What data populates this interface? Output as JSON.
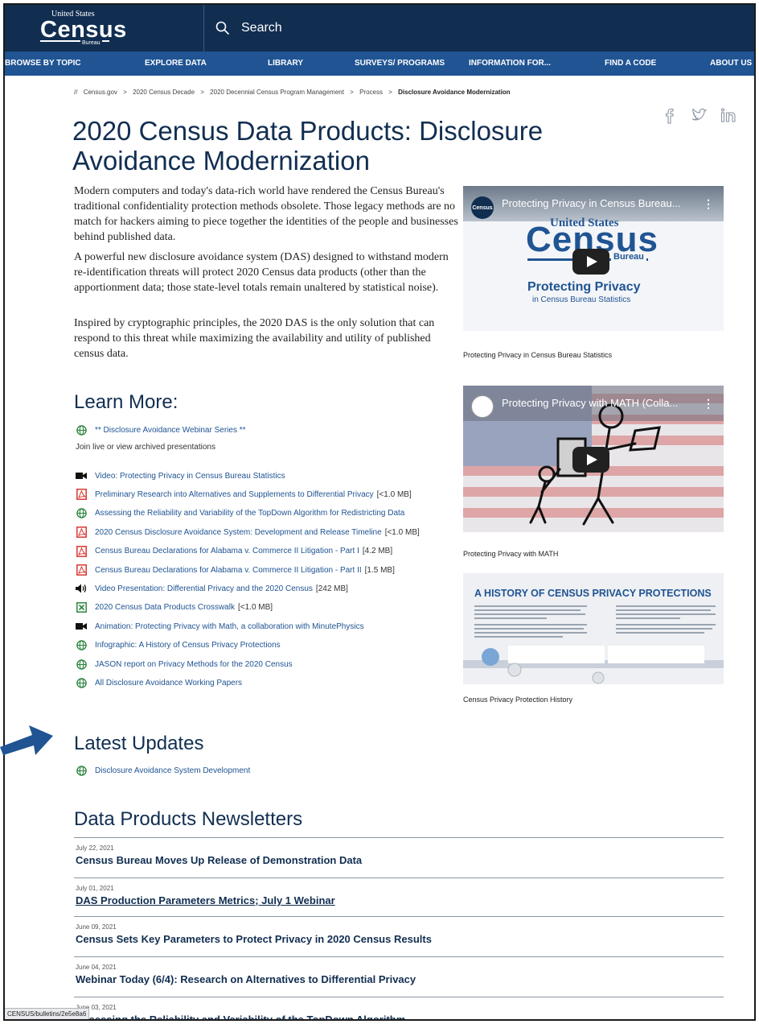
{
  "header": {
    "logo_top": "United States",
    "logo_main": "Census",
    "logo_bottom": "Bureau",
    "search_label": "Search"
  },
  "nav": [
    "BROWSE BY TOPIC",
    "EXPLORE DATA",
    "LIBRARY",
    "SURVEYS/ PROGRAMS",
    "INFORMATION FOR...",
    "FIND A CODE",
    "ABOUT US"
  ],
  "breadcrumb": {
    "root": "//",
    "items": [
      "Census.gov",
      "2020 Census Decade",
      "2020 Decennial Census Program Management",
      "Process"
    ],
    "sep": ">",
    "current": "Disclosure Avoidance Modernization"
  },
  "page_title": "2020 Census Data Products: Disclosure Avoidance Modernization",
  "intro": [
    "Modern computers and today's data-rich world have rendered the Census Bureau's traditional confidentiality protection methods obsolete. Those legacy methods are no match for hackers aiming to piece together the identities of the people and businesses behind published data.",
    "A powerful new disclosure avoidance system (DAS) designed to withstand modern re-identification threats will protect 2020 Census data products (other than the apportionment data; those state-level totals remain unaltered by statistical noise).",
    "Inspired by cryptographic principles, the 2020 DAS is the only solution that can respond to this threat while maximizing the availability and utility of published census data."
  ],
  "media": {
    "video1": {
      "title": "Protecting Privacy in Census Bureau...",
      "menu": "⋮",
      "thumb_us": "United States",
      "thumb_census": "Census",
      "thumb_bureau": "Bureau",
      "thumb_h": "Protecting Privacy",
      "thumb_s": "in Census Bureau Statistics",
      "caption": "Protecting Privacy in Census Bureau Statistics"
    },
    "video2": {
      "title": "Protecting Privacy with MATH (Colla...",
      "menu": "⋮",
      "caption": "Protecting Privacy with MATH"
    },
    "infographic": {
      "heading": "A HISTORY OF CENSUS PRIVACY PROTECTIONS",
      "caption": "Census Privacy Protection History"
    }
  },
  "learn_more": {
    "heading": "Learn More:",
    "webinar": "** Disclosure Avoidance Webinar Series **",
    "webinar_note": "Join live or view archived presentations",
    "items": [
      {
        "icon": "video",
        "label": "Video: Protecting Privacy in Census Bureau Statistics",
        "size": ""
      },
      {
        "icon": "pdf",
        "label": "Preliminary Research into Alternatives and Supplements to Differential Privacy",
        "size": "[<1.0 MB]"
      },
      {
        "icon": "web",
        "label": "Assessing the Reliability and Variability of the TopDown Algorithm for Redistricting Data",
        "size": ""
      },
      {
        "icon": "pdf",
        "label": "2020 Census Disclosure Avoidance System: Development and Release Timeline",
        "size": "[<1.0 MB]"
      },
      {
        "icon": "pdf",
        "label": "Census Bureau Declarations for Alabama v. Commerce II Litigation - Part I",
        "size": "[4.2 MB]"
      },
      {
        "icon": "pdf",
        "label": "Census Bureau Declarations for Alabama v. Commerce II Litigation - Part II",
        "size": "[1.5 MB]"
      },
      {
        "icon": "audio",
        "label": "Video Presentation: Differential Privacy and the 2020 Census",
        "size": "[242 MB]"
      },
      {
        "icon": "excel",
        "label": "2020 Census Data Products Crosswalk",
        "size": "[<1.0 MB]"
      },
      {
        "icon": "video",
        "label": "Animation: Protecting Privacy with Math, a collaboration with MinutePhysics",
        "size": ""
      },
      {
        "icon": "web",
        "label": "Infographic: A History of Census Privacy Protections",
        "size": ""
      },
      {
        "icon": "web",
        "label": "JASON report on Privacy Methods for the 2020 Census",
        "size": ""
      },
      {
        "icon": "web",
        "label": "All Disclosure Avoidance Working Papers",
        "size": ""
      }
    ]
  },
  "latest_updates": {
    "heading": "Latest Updates",
    "items": [
      "Disclosure Avoidance System Development"
    ]
  },
  "newsletters": {
    "heading": "Data Products Newsletters",
    "items": [
      {
        "date": "July 22, 2021",
        "title": "Census Bureau Moves Up Release of Demonstration Data"
      },
      {
        "date": "July 01, 2021",
        "title": "DAS Production Parameters Metrics; July 1 Webinar"
      },
      {
        "date": "June 09, 2021",
        "title": "Census Sets Key Parameters to Protect Privacy in 2020 Census Results"
      },
      {
        "date": "June 04, 2021",
        "title": "Webinar Today (6/4): Research on Alternatives to Differential Privacy"
      },
      {
        "date": "June 03, 2021",
        "title": "Assessing the Reliability and Variability of the TopDown Algorithm"
      }
    ]
  },
  "status_url": "CENSUS/bulletins/2e5e8a6",
  "colors": {
    "header": "#112e51",
    "nav": "#205493",
    "link": "#205493",
    "pdf": "#d83933",
    "web": "#2e8540",
    "arrow": "#205493"
  }
}
